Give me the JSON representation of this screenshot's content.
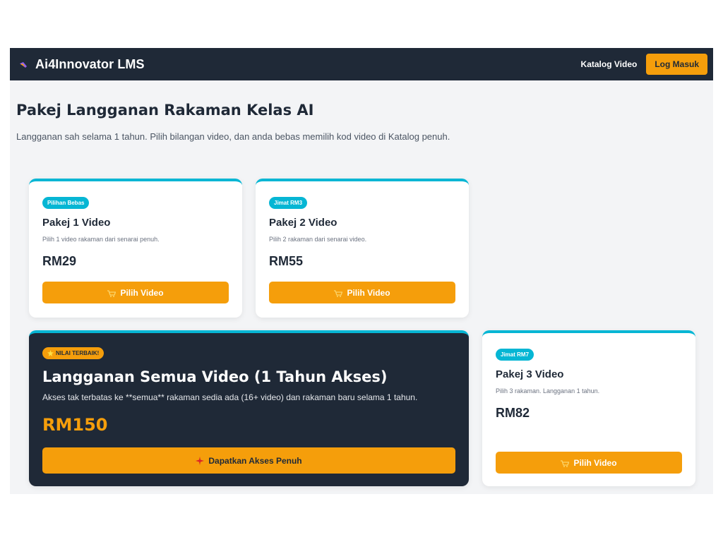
{
  "navbar": {
    "brand": "Ai4Innovator LMS",
    "brand_icon": "sparkle-logo-icon",
    "catalog_link": "Katalog Video",
    "login_button": "Log Masuk"
  },
  "page": {
    "title": "Pakej Langganan Rakaman Kelas AI",
    "subtitle": "Langganan sah selama 1 tahun. Pilih bilangan video, dan anda bebas memilih kod video di Katalog penuh."
  },
  "plans": [
    {
      "badge": "Pilihan Bebas",
      "title": "Pakej 1 Video",
      "desc": "Pilih 1 video rakaman dari senarai penuh.",
      "price": "RM29",
      "cta": "Pilih Video",
      "cta_icon": "cart-icon"
    },
    {
      "badge": "Jimat RM3",
      "title": "Pakej 2 Video",
      "desc": "Pilih 2 rakaman dari senarai video.",
      "price": "RM55",
      "cta": "Pilih Video",
      "cta_icon": "cart-icon"
    },
    {
      "badge": "Jimat RM7",
      "title": "Pakej 3 Video",
      "desc": "Pilih 3 rakaman. Langganan 1 tahun.",
      "price": "RM82",
      "cta": "Pilih Video",
      "cta_icon": "cart-icon"
    }
  ],
  "premium": {
    "badge": "NILAI TERBAIK!",
    "badge_icon": "star-icon",
    "title": "Langganan Semua Video (1 Tahun Akses)",
    "desc": "Akses tak terbatas ke **semua** rakaman sedia ada (16+ video) dan rakaman baru selama 1 tahun.",
    "price": "RM150",
    "cta": "Dapatkan Akses Penuh",
    "cta_icon": "sparkle-icon"
  },
  "colors": {
    "nav_bg": "#1f2937",
    "accent": "#f59e0b",
    "card_top_border": "#06b6d4",
    "page_bg": "#f3f4f6"
  }
}
